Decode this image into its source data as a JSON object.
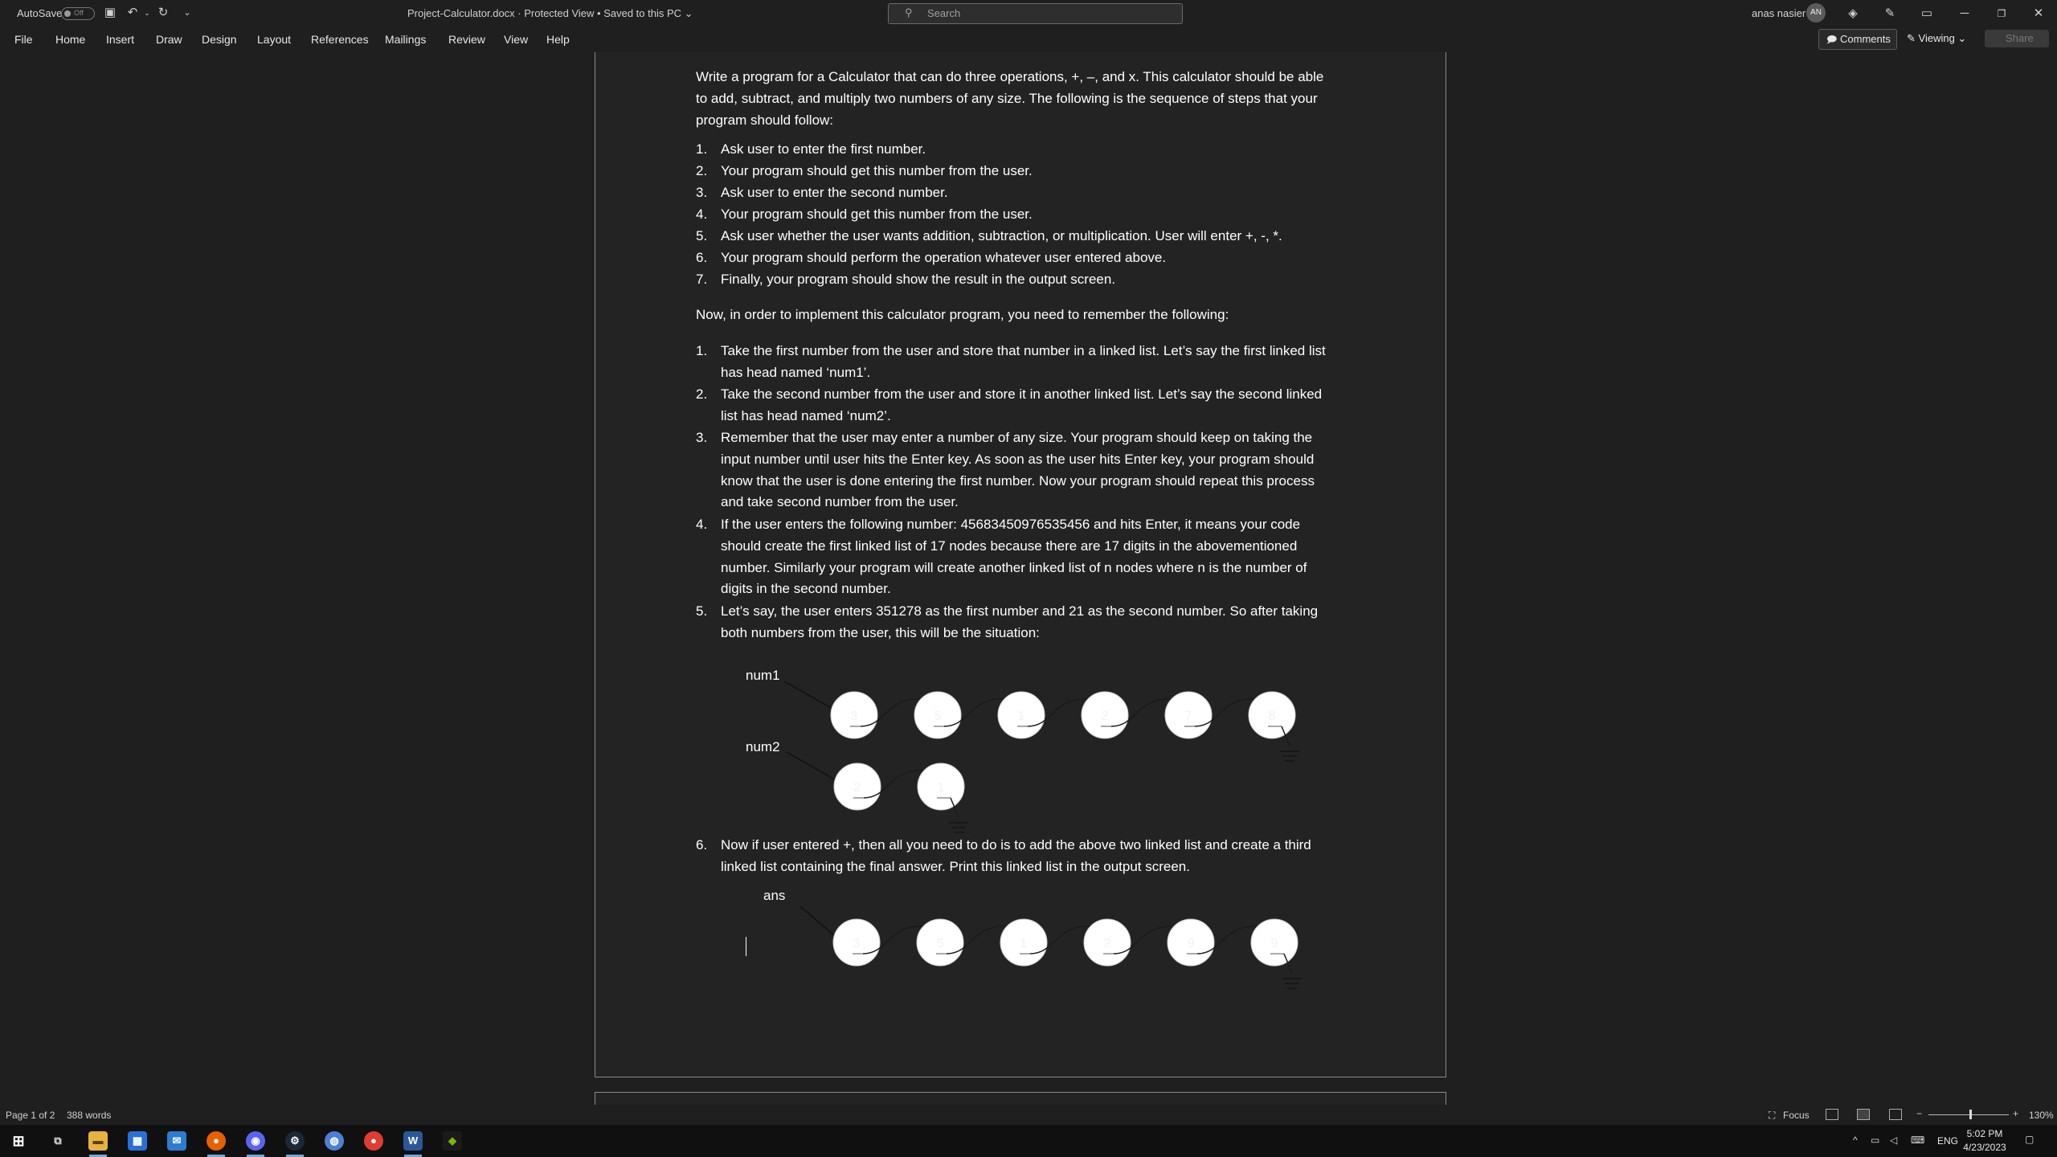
{
  "titlebar": {
    "autosave_label": "AutoSave",
    "autosave_state": "Off",
    "doc_title": "Project-Calculator.docx  ·  Protected View  •  Saved to this PC ⌄",
    "search_placeholder": "Search",
    "user_name": "anas nasier",
    "user_initials": "AN"
  },
  "ribbon": {
    "tabs": [
      "File",
      "Home",
      "Insert",
      "Draw",
      "Design",
      "Layout",
      "References",
      "Mailings",
      "Review",
      "View",
      "Help"
    ],
    "comments_label": "Comments",
    "viewing_label": "Viewing ⌄",
    "share_label": "Share"
  },
  "document": {
    "intro": "Write a program for a Calculator that can do three operations, +, –, and x. This calculator should be able to add, subtract, and multiply two numbers of any size. The following is the sequence of steps that your program should follow:",
    "steps": [
      {
        "num": "1.",
        "text": "Ask user to enter the first number."
      },
      {
        "num": "2.",
        "text": "Your program should get this number from the user."
      },
      {
        "num": "3.",
        "text": "Ask user to enter the second number."
      },
      {
        "num": "4.",
        "text": "Your program should get this number from the user."
      },
      {
        "num": "5.",
        "text": "Ask user whether the user wants addition, subtraction, or multiplication. User will enter +, -, *."
      },
      {
        "num": "6.",
        "text": "Your program should perform the operation whatever user entered above."
      },
      {
        "num": "7.",
        "text": "Finally, your program should show the result in the output screen."
      }
    ],
    "middle": "Now, in order to implement this calculator program, you need to remember the following:",
    "rules": [
      {
        "num": "1.",
        "text": "Take the first number from the user and store that number in a linked list. Let’s say the first linked list has head named ‘num1’."
      },
      {
        "num": "2.",
        "text": "Take the second number from the user and store it in another linked list. Let’s say the second linked list has head named ‘num2’."
      },
      {
        "num": "3.",
        "text": "Remember that the user may enter a number of any size. Your program should keep on taking the input number until user hits the Enter key. As soon as the user hits Enter key, your program should know that the user is done entering the first number. Now your program should repeat this process and take second number from the user."
      },
      {
        "num": "4.",
        "text": "If the user enters the following number: 45683450976535456 and hits Enter, it means your code should create the first linked list of 17 nodes because there are 17 digits in the abovementioned number. Similarly your program will create another linked list of n nodes where n is the number of digits in the second number."
      },
      {
        "num": "5.",
        "text": "Let’s say, the user enters 351278 as the first number and 21 as the second number. So after taking both numbers from the user, this will be the situation:"
      }
    ],
    "rule6": {
      "num": "6.",
      "text": "Now if user entered +, then all you need to do is to add the above two linked list and create a third linked list containing the final answer. Print this linked list in the output screen."
    },
    "labels": {
      "num1": "num1",
      "num2": "num2",
      "ans": "ans"
    },
    "num1_digits": [
      "3",
      "5",
      "1",
      "2",
      "7",
      "8"
    ],
    "num2_digits": [
      "2",
      "1"
    ],
    "ans_digits": [
      "3",
      "5",
      "1",
      "2",
      "9",
      "9"
    ]
  },
  "statusbar": {
    "page": "Page 1 of 2",
    "words": "388 words",
    "focus": "Focus",
    "zoom": "130%"
  },
  "taskbar": {
    "lang": "ENG",
    "time": "5:02 PM",
    "date": "4/23/2023"
  }
}
